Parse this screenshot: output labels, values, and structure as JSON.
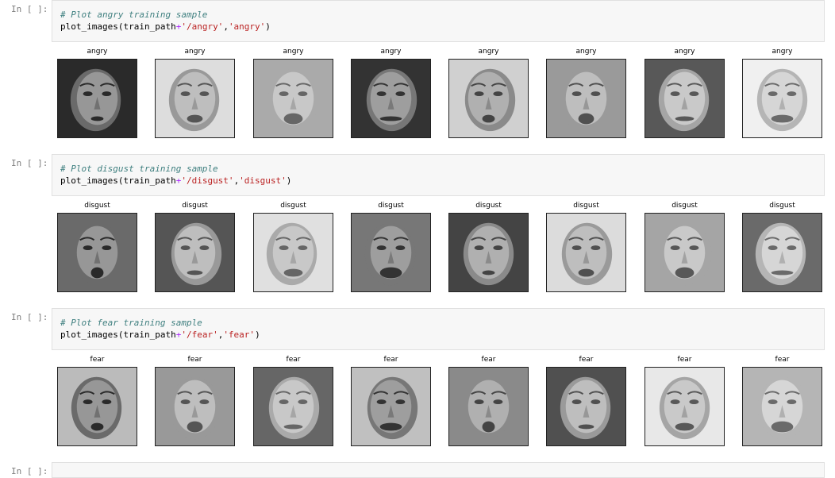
{
  "cells": [
    {
      "prompt": "In [ ]:",
      "comment": "# Plot angry training sample",
      "code": {
        "fn": "plot_images(train_path",
        "op": "+",
        "path": "'/angry'",
        "sep": ",",
        "label": "'angry'",
        "end": ")"
      },
      "image_titles": [
        "angry",
        "angry",
        "angry",
        "angry",
        "angry",
        "angry",
        "angry",
        "angry"
      ]
    },
    {
      "prompt": "In [ ]:",
      "comment": "# Plot disgust training sample",
      "code": {
        "fn": "plot_images(train_path",
        "op": "+",
        "path": "'/disgust'",
        "sep": ",",
        "label": "'disgust'",
        "end": ")"
      },
      "image_titles": [
        "disgust",
        "disgust",
        "disgust",
        "disgust",
        "disgust",
        "disgust",
        "disgust",
        "disgust"
      ]
    },
    {
      "prompt": "In [ ]:",
      "comment": "# Plot fear training sample",
      "code": {
        "fn": "plot_images(train_path",
        "op": "+",
        "path": "'/fear'",
        "sep": ",",
        "label": "'fear'",
        "end": ")"
      },
      "image_titles": [
        "fear",
        "fear",
        "fear",
        "fear",
        "fear",
        "fear",
        "fear",
        "fear"
      ]
    }
  ],
  "next_cell_prompt": "In [ ]:",
  "colors": {
    "code_bg": "#f7f7f7",
    "comment": "#408080",
    "string": "#ba2121",
    "operator": "#aa22ff",
    "prompt": "#7f7f7f"
  }
}
